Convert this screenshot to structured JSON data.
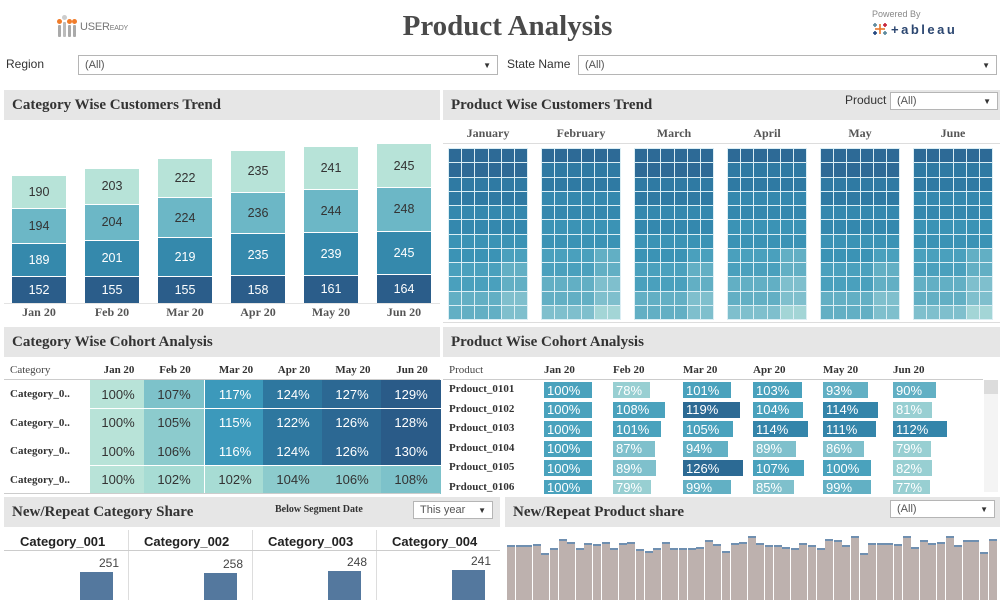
{
  "header": {
    "title": "Product Analysis",
    "left_logo_text": "USER",
    "left_logo_small": "EADY",
    "powered_by": "Powered By",
    "tableau_word": "+ableau"
  },
  "filters": {
    "region_label": "Region",
    "region_value": "(All)",
    "state_label": "State Name",
    "state_value": "(All)"
  },
  "colors": {
    "seg1": "#2b5d8a",
    "seg2": "#3589ac",
    "seg3": "#6cb7c6",
    "seg4": "#b7e3d8",
    "panel_bg": "#e6e6e6",
    "product_bar": "#bdb1ae",
    "category_share_bar": "#54789e"
  },
  "category_trend": {
    "title": "Category Wise Customers Trend",
    "chart_data": {
      "type": "bar",
      "stacked": true,
      "categories": [
        "Jan 20",
        "Feb 20",
        "Mar 20",
        "Apr 20",
        "May 20",
        "Jun 20"
      ],
      "series": [
        {
          "name": "Category_001",
          "values": [
            152,
            155,
            155,
            158,
            161,
            164
          ]
        },
        {
          "name": "Category_002",
          "values": [
            189,
            201,
            219,
            235,
            239,
            245
          ]
        },
        {
          "name": "Category_003",
          "values": [
            194,
            204,
            224,
            236,
            244,
            248
          ]
        },
        {
          "name": "Category_004",
          "values": [
            190,
            203,
            222,
            235,
            241,
            245
          ]
        }
      ]
    }
  },
  "product_trend": {
    "title": "Product Wise Customers Trend",
    "filter_label": "Product",
    "filter_value": "(All)",
    "months": [
      "January",
      "February",
      "March",
      "April",
      "May",
      "June"
    ]
  },
  "category_cohort": {
    "title": "Category Wise Cohort Analysis",
    "row_header": "Category",
    "columns": [
      "Jan 20",
      "Feb 20",
      "Mar 20",
      "Apr 20",
      "May 20",
      "Jun 20"
    ],
    "rows": [
      {
        "label": "Category_0..",
        "values": [
          "100%",
          "107%",
          "117%",
          "124%",
          "127%",
          "129%"
        ]
      },
      {
        "label": "Category_0..",
        "values": [
          "100%",
          "105%",
          "115%",
          "122%",
          "126%",
          "128%"
        ]
      },
      {
        "label": "Category_0..",
        "values": [
          "100%",
          "106%",
          "116%",
          "124%",
          "126%",
          "130%"
        ]
      },
      {
        "label": "Category_0..",
        "values": [
          "100%",
          "102%",
          "102%",
          "104%",
          "106%",
          "108%"
        ]
      }
    ]
  },
  "product_cohort": {
    "title": "Product Wise Cohort Analysis",
    "row_header": "Product",
    "columns": [
      "Jan 20",
      "Feb 20",
      "Mar 20",
      "Apr 20",
      "May 20",
      "Jun 20"
    ],
    "rows": [
      {
        "label": "Prdouct_0101",
        "values": [
          "100%",
          "78%",
          "101%",
          "103%",
          "93%",
          "90%"
        ]
      },
      {
        "label": "Prdouct_0102",
        "values": [
          "100%",
          "108%",
          "119%",
          "104%",
          "114%",
          "81%"
        ]
      },
      {
        "label": "Prdouct_0103",
        "values": [
          "100%",
          "101%",
          "105%",
          "114%",
          "111%",
          "112%"
        ]
      },
      {
        "label": "Prdouct_0104",
        "values": [
          "100%",
          "87%",
          "94%",
          "89%",
          "86%",
          "79%"
        ]
      },
      {
        "label": "Prdouct_0105",
        "values": [
          "100%",
          "89%",
          "126%",
          "107%",
          "100%",
          "82%"
        ]
      },
      {
        "label": "Prdouct_0106",
        "values": [
          "100%",
          "79%",
          "99%",
          "85%",
          "99%",
          "77%"
        ]
      }
    ]
  },
  "category_share": {
    "title": "New/Repeat Category Share",
    "segment_label": "Below Segment Date",
    "segment_value": "This year",
    "chart_data": {
      "type": "bar",
      "categories": [
        "Category_001",
        "Category_002",
        "Category_003",
        "Category_004"
      ],
      "values": [
        251,
        258,
        248,
        241
      ]
    }
  },
  "product_share": {
    "title": "New/Repeat Product share",
    "filter_value": "(All)",
    "chart_data": {
      "type": "bar",
      "note": "unlabeled relative heights",
      "values": [
        92,
        92,
        92,
        93,
        86,
        90,
        97,
        95,
        90,
        94,
        93,
        95,
        90,
        94,
        95,
        89,
        88,
        90,
        95,
        90,
        90,
        90,
        91,
        96,
        93,
        88,
        94,
        95,
        99,
        94,
        92,
        92,
        91,
        90,
        94,
        92,
        90,
        97,
        96,
        92,
        99,
        86,
        94,
        94,
        94,
        93,
        99,
        91,
        96,
        94,
        95,
        99,
        92,
        96,
        96,
        87,
        97
      ]
    }
  }
}
